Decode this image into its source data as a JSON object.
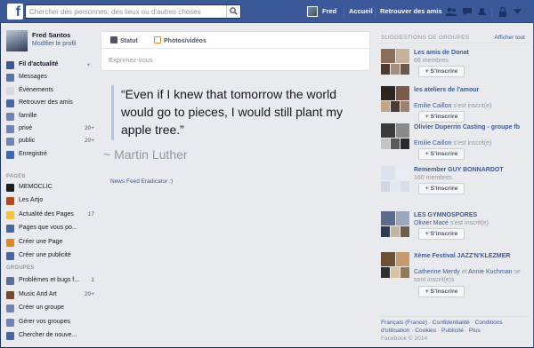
{
  "colors": {
    "brand": "#3b5998",
    "link": "#3b5998",
    "muted": "#9197a3",
    "background": "#e9eaed"
  },
  "header": {
    "logo": "f",
    "search": {
      "placeholder": "Chercher des personnes, des lieux ou d'autres choses",
      "value": ""
    },
    "user_name": "Fred",
    "home_label": "Accueil",
    "find_friends_label": "Retrouver des amis",
    "icons": [
      "friend-requests-icon",
      "messages-icon",
      "notifications-icon",
      "privacy-lock-icon",
      "settings-icon"
    ]
  },
  "profile": {
    "name": "Fred Santos",
    "edit_label": "Modifier le profil"
  },
  "nav": {
    "main": [
      {
        "label": "Fil d'actualité",
        "icon": "news-feed-icon",
        "color": "#3b5998",
        "bold": true
      },
      {
        "label": "Messages",
        "icon": "messages-icon",
        "color": "#5a77ad"
      },
      {
        "label": "Évènements",
        "icon": "calendar-icon",
        "color": "#d7d9dd",
        "count": ""
      },
      {
        "label": "Retrouver des amis",
        "icon": "find-friends-icon",
        "color": "#4a67a4"
      },
      {
        "label": "famille",
        "icon": "list-icon",
        "color": "#6d84b4"
      },
      {
        "label": "privé",
        "icon": "list-icon",
        "color": "#6d84b4",
        "count": "20+"
      },
      {
        "label": "public",
        "icon": "list-icon",
        "color": "#6d84b4",
        "count": "20+"
      },
      {
        "label": "Enregistré",
        "icon": "bookmark-icon",
        "color": "#4267b2"
      }
    ],
    "pages_title": "PAGES",
    "pages": [
      {
        "label": "MEMOCLIC",
        "icon": "page-icon",
        "color": "#1c1e21"
      },
      {
        "label": "Les Artjo",
        "icon": "page-icon",
        "color": "#b54b1c"
      },
      {
        "label": "Actualité des Pages",
        "icon": "pages-feed-icon",
        "color": "#f5c33b",
        "count": "17"
      },
      {
        "label": "Pages que vous po...",
        "icon": "pages-icon",
        "color": "#4a67a4"
      },
      {
        "label": "Créer une Page",
        "icon": "create-page-icon",
        "color": "#e08a1e"
      },
      {
        "label": "Créer une publicité",
        "icon": "create-ad-icon",
        "color": "#4a67a4"
      }
    ],
    "groups_title": "GROUPES",
    "groups": [
      {
        "label": "Problèmes et bugs f...",
        "icon": "group-icon",
        "color": "#5c6e99",
        "count": "1"
      },
      {
        "label": "Music And Art",
        "icon": "guitar-icon",
        "color": "#7a4a2a",
        "count": "20+"
      },
      {
        "label": "Créer un groupe",
        "icon": "create-group-icon",
        "color": "#6d84b4"
      },
      {
        "label": "Gérer vos groupes",
        "icon": "manage-groups-icon",
        "color": "#6d84b4"
      },
      {
        "label": "Chercher de nouve...",
        "icon": "search-groups-icon",
        "color": "#4a67a4"
      }
    ]
  },
  "composer": {
    "status_label": "Statut",
    "photo_label": "Photos/vidéos",
    "placeholder": "Exprimez-vous"
  },
  "feed": {
    "quote": "“Even if I knew that tomorrow the world would go to pieces, I would still plant my apple tree.”",
    "author": "~ Martin Luther",
    "eradicator_label": "News Feed Eradicator :)"
  },
  "suggestions": {
    "title": "SUGGESTIONS DE GROUPES",
    "see_all": "Afficher tout",
    "join_label": "+ S'inscrire",
    "items": [
      {
        "name": "Les amis de Donat",
        "meta_plain": "66 membres",
        "member": "",
        "action": ""
      },
      {
        "name": "les ateliers de l'amour",
        "meta_plain": "",
        "member": "Emilie Caillon",
        "action": " s'est inscrit(e)"
      },
      {
        "name": "Olivier Duperrin Casting - groupe fb",
        "meta_plain": "",
        "member": "Emilie Caillon",
        "action": " s'est inscrit(e)"
      },
      {
        "name": "Remember GUY BONNARDOT",
        "meta_plain": "160 membres",
        "member": "",
        "action": ""
      },
      {
        "name": "LES GYMNOSPORES",
        "meta_plain": "",
        "member": "Olivier Macé",
        "action": " s'est inscrit(e)"
      },
      {
        "name": "Xème Festival JAZZ'N'KLEZMER",
        "meta_plain": "",
        "member": "Catherine Merdy",
        "connector": " et ",
        "member2": "Annie Kuchman",
        "action": " se sont inscrit(e)s"
      }
    ]
  },
  "footer": {
    "links": [
      "Français (France)",
      "Confidentialité",
      "Conditions d'utilisation",
      "Cookies",
      "Publicité",
      "Plus"
    ],
    "copyright": "Facebook © 2014"
  }
}
